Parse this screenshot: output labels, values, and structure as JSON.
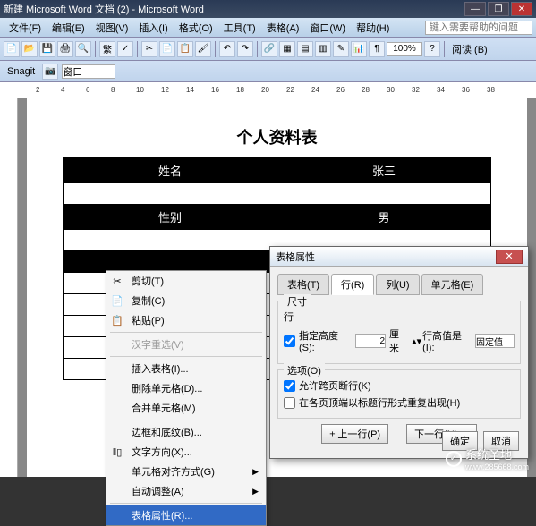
{
  "titlebar": {
    "title": "新建 Microsoft Word 文档 (2) - Microsoft Word"
  },
  "menubar": {
    "items": [
      "文件(F)",
      "编辑(E)",
      "视图(V)",
      "插入(I)",
      "格式(O)",
      "工具(T)",
      "表格(A)",
      "窗口(W)",
      "帮助(H)"
    ],
    "help_placeholder": "键入需要帮助的问题"
  },
  "toolbar": {
    "font_convert": "繁",
    "zoom": "100%",
    "read_btn": "阅读 (B)"
  },
  "toolbar2": {
    "snagit": "Snagit",
    "window_opt": "窗口"
  },
  "ruler_marks": [
    "2",
    "4",
    "6",
    "8",
    "10",
    "12",
    "14",
    "16",
    "18",
    "20",
    "22",
    "24",
    "26",
    "28",
    "30",
    "32",
    "34",
    "36",
    "38"
  ],
  "document": {
    "title": "个人资料表",
    "rows": [
      {
        "label": "姓名",
        "value": "张三"
      },
      {
        "label": "性别",
        "value": "男"
      }
    ]
  },
  "context_menu": {
    "items": [
      {
        "icon": "✂",
        "label": "剪切(T)"
      },
      {
        "icon": "📄",
        "label": "复制(C)"
      },
      {
        "icon": "📋",
        "label": "粘贴(P)"
      },
      {
        "icon": "",
        "label": "汉字重选(V)",
        "disabled": true
      },
      {
        "icon": "",
        "label": "插入表格(I)..."
      },
      {
        "icon": "",
        "label": "删除单元格(D)..."
      },
      {
        "icon": "",
        "label": "合并单元格(M)"
      },
      {
        "icon": "",
        "label": "边框和底纹(B)..."
      },
      {
        "icon": "‖▯",
        "label": "文字方向(X)..."
      },
      {
        "icon": "",
        "label": "单元格对齐方式(G)",
        "arrow": true
      },
      {
        "icon": "",
        "label": "自动调整(A)",
        "arrow": true
      },
      {
        "icon": "",
        "label": "表格属性(R)...",
        "highlighted": true
      }
    ]
  },
  "dialog": {
    "title": "表格属性",
    "tabs": [
      "表格(T)",
      "行(R)",
      "列(U)",
      "单元格(E)"
    ],
    "active_tab": 1,
    "size_group": "尺寸",
    "row_label": "行",
    "specify_height": "指定高度(S):",
    "height_value": "2",
    "height_unit": "厘米",
    "height_is_label": "行高值是(I):",
    "height_is_value": "固定值",
    "options_group": "选项(O)",
    "allow_break": "允许跨页断行(K)",
    "repeat_header": "在各页顶端以标题行形式重复出现(H)",
    "prev_row": "上一行(P)",
    "next_row": "下一行(N)",
    "ok": "确定",
    "cancel": "取消"
  },
  "watermark": {
    "text": "系统圣地",
    "url": "www.285668.com"
  }
}
